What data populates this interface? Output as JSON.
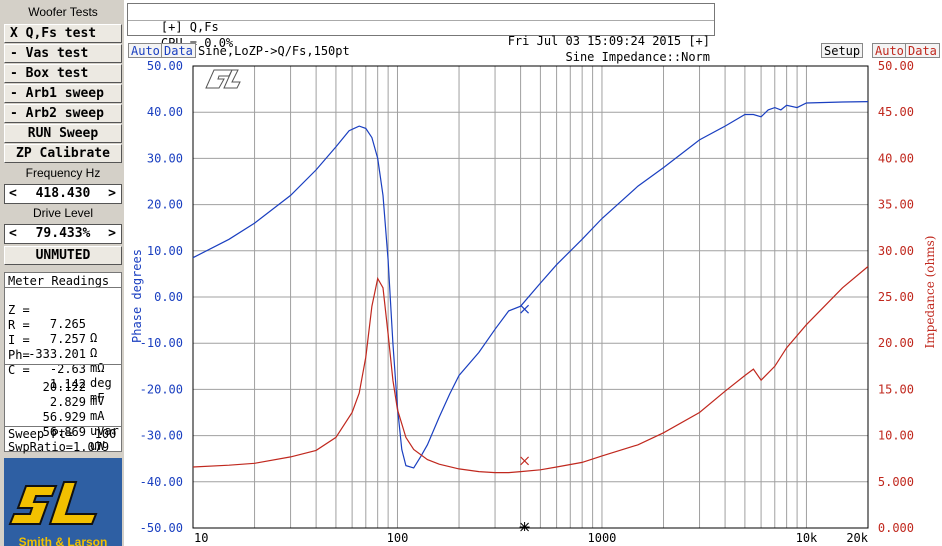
{
  "sidebar": {
    "title": "Woofer Tests",
    "buttons": [
      {
        "label": "X Q,Fs test"
      },
      {
        "label": "- Vas test"
      },
      {
        "label": "- Box test"
      },
      {
        "label": "- Arb1 sweep"
      },
      {
        "label": "- Arb2 sweep"
      },
      {
        "label": "RUN Sweep"
      },
      {
        "label": "ZP Calibrate"
      }
    ],
    "frequency": {
      "label": "Frequency Hz",
      "left": "<",
      "value": "418.430",
      "right": ">"
    },
    "drive": {
      "label": "Drive Level",
      "left": "<",
      "value": "79.433%",
      "right": ">"
    },
    "mute_button": "UNMUTED",
    "meter": {
      "title": "Meter Readings",
      "rows": [
        {
          "label": "Z =",
          "value": "7.265",
          "unit": "Ω"
        },
        {
          "label": "R =",
          "value": "7.257",
          "unit": "Ω"
        },
        {
          "label": "I =",
          "value": "-333.201",
          "unit": "mΩ"
        },
        {
          "label": "Ph=",
          "value": "-2.63",
          "unit": "deg"
        },
        {
          "label": "C =",
          "value": "1.142",
          "unit": "mF"
        }
      ],
      "readings": [
        {
          "value": "20.122",
          "unit": "mV"
        },
        {
          "value": "2.829",
          "unit": "mA"
        },
        {
          "value": "56.929",
          "unit": "uVar"
        },
        {
          "value": "56.869",
          "unit": "uW"
        }
      ],
      "sweep_pt": "Sweep Pt=   100",
      "swp_ratio": "SwpRatio=1.079"
    },
    "logo_text": "Smith & Larson"
  },
  "header": {
    "left_top": "[+] Q,Fs",
    "right_top": "Fri Jul 03 15:09:24 2015 [+]",
    "left_bottom": "CPU = 0.0%",
    "right_bottom": "Sine Impedance::Norm"
  },
  "toolbar": {
    "left_auto": "Auto",
    "left_data": "Data",
    "plot_title": "Sine,LoZP->Q/Fs,150pt",
    "setup": "Setup",
    "right_auto": "Auto",
    "right_data": "Data"
  },
  "colors": {
    "phase": "#1a3fc0",
    "impedance": "#c0281e",
    "grid": "#a0a0a0",
    "panel": "#d4d0c8"
  },
  "chart_data": {
    "type": "line",
    "x_scale": "log",
    "xlim": [
      10,
      20000
    ],
    "x_ticks": [
      10,
      100,
      1000,
      10000,
      20000
    ],
    "x_tick_labels": [
      "10",
      "100",
      "1000",
      "10k",
      "20k"
    ],
    "ylabel": "Phase degrees",
    "ylim": [
      -50,
      50
    ],
    "y_ticks": [
      "50.00",
      "40.00",
      "30.00",
      "20.00",
      "10.00",
      "0.00",
      "-10.00",
      "-20.00",
      "-30.00",
      "-40.00",
      "-50.00"
    ],
    "y2label": "Impedance (ohms)",
    "y2lim": [
      0,
      50
    ],
    "y2_ticks": [
      "50.00",
      "45.00",
      "40.00",
      "35.00",
      "30.00",
      "25.00",
      "20.00",
      "15.00",
      "10.00",
      "5.000",
      "0.000"
    ],
    "series": [
      {
        "axis": "left",
        "x": [
          10,
          15,
          20,
          30,
          40,
          50,
          58,
          65,
          70,
          75,
          80,
          85,
          90,
          95,
          100,
          105,
          110,
          120,
          130,
          140,
          160,
          180,
          200,
          250,
          300,
          350,
          400,
          500,
          600,
          800,
          1000,
          1500,
          2000,
          3000,
          4000,
          5000,
          5500,
          6000,
          6500,
          7000,
          7500,
          8000,
          9000,
          10000,
          15000,
          20000
        ],
        "y": [
          8.5,
          12.5,
          16,
          22,
          27.5,
          32.5,
          36,
          37,
          36.5,
          34.5,
          30,
          22,
          8,
          -10,
          -24,
          -33,
          -36.5,
          -37,
          -34.5,
          -32,
          -26,
          -21,
          -17,
          -12,
          -7,
          -3,
          -2,
          3,
          7,
          12.5,
          17,
          24,
          28,
          34,
          37,
          39.5,
          39.5,
          39,
          40.5,
          41,
          40.5,
          41.5,
          41,
          42,
          42.2,
          42.3
        ]
      },
      {
        "axis": "right",
        "x": [
          10,
          15,
          20,
          30,
          40,
          50,
          60,
          65,
          70,
          75,
          80,
          85,
          90,
          95,
          100,
          110,
          120,
          140,
          160,
          200,
          250,
          300,
          350,
          400,
          500,
          600,
          800,
          1000,
          1500,
          2000,
          3000,
          4000,
          5000,
          5500,
          6000,
          7000,
          8000,
          10000,
          15000,
          20000
        ],
        "y": [
          6.6,
          6.8,
          7.0,
          7.7,
          8.4,
          9.8,
          12.5,
          14.6,
          18.5,
          24,
          27,
          26,
          21,
          16,
          12.8,
          9.8,
          8.5,
          7.4,
          6.9,
          6.4,
          6.1,
          6.0,
          6.0,
          6.1,
          6.3,
          6.6,
          7.1,
          7.8,
          9.0,
          10.3,
          12.5,
          14.8,
          16.5,
          17.2,
          16.0,
          17.5,
          19.5,
          22,
          26,
          28.3
        ]
      }
    ],
    "markers": [
      {
        "series": 0,
        "x": 418.43,
        "y": -2.63
      },
      {
        "series": 1,
        "x": 418.43,
        "y": 7.265
      }
    ],
    "frequency_marker_x": 418.43
  }
}
